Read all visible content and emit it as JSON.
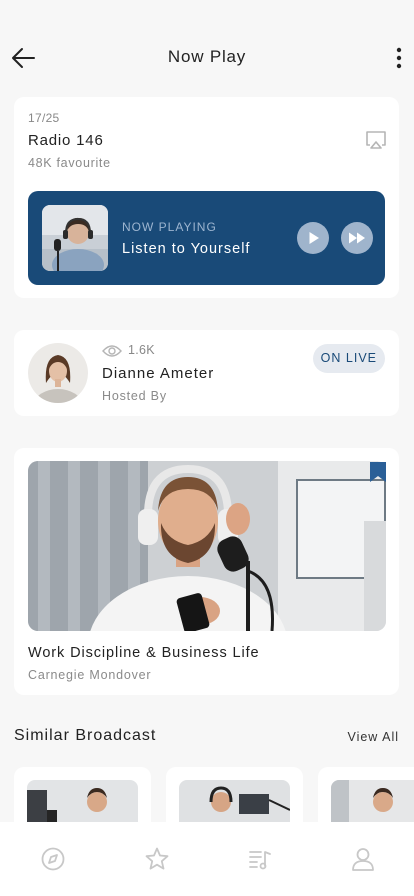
{
  "header": {
    "title": "Now Play",
    "back_icon": "arrow-left-icon",
    "menu_icon": "more-vertical-icon"
  },
  "radio": {
    "count": "17/25",
    "name": "Radio 146",
    "favourite": "48K favourite",
    "cast_icon": "cast-icon"
  },
  "player": {
    "label": "NOW PLAYING",
    "title": "Listen to Yourself",
    "background_color": "#194a78",
    "play_icon": "play-icon",
    "forward_icon": "fast-forward-icon"
  },
  "host": {
    "views": "1.6K",
    "name": "Dianne Ameter",
    "role": "Hosted By",
    "live_badge": "ON LIVE"
  },
  "featured": {
    "title": "Work Discipline & Business Life",
    "author": "Carnegie Mondover",
    "bookmark_icon": "bookmark-icon"
  },
  "similar": {
    "section_title": "Similar Broadcast",
    "view_all": "View All"
  },
  "tabbar": {
    "items": [
      "compass-icon",
      "star-icon",
      "playlist-icon",
      "profile-icon"
    ]
  }
}
